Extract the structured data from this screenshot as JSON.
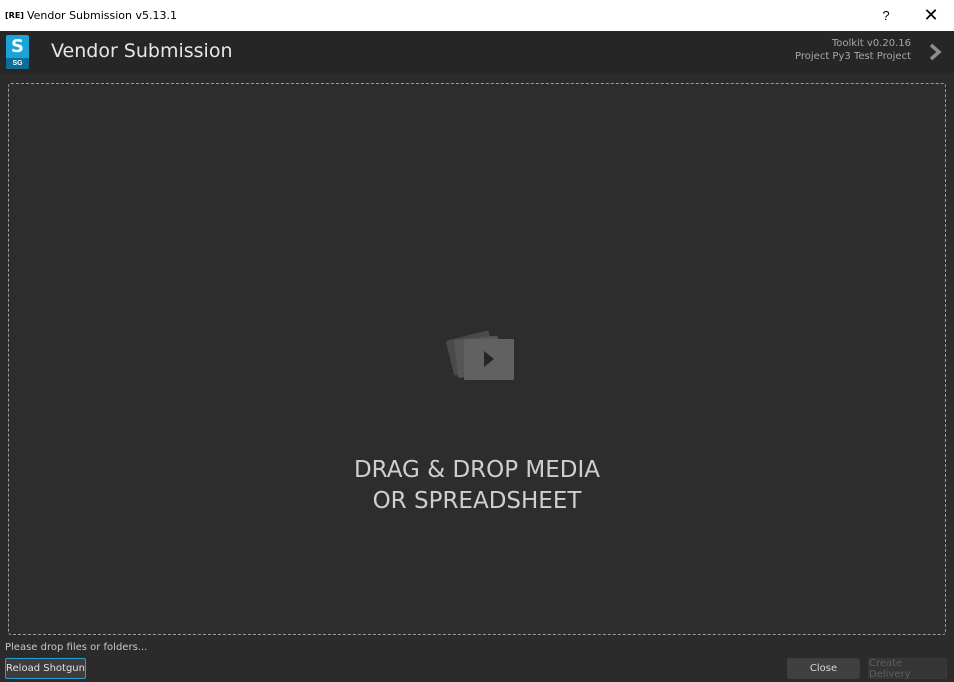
{
  "window": {
    "app_tag": "[RE]",
    "title": "Vendor Submission v5.13.1",
    "help_label": "?",
    "close_label": "✕"
  },
  "header": {
    "logo_letter": "S",
    "logo_sub": "SG",
    "title": "Vendor Submission",
    "toolkit_version": "Toolkit v0.20.16",
    "project": "Project Py3 Test Project",
    "accent_color": "#19a3d8"
  },
  "drop_zone": {
    "icon": "media-play-icon",
    "line1": "DRAG & DROP MEDIA",
    "line2": "OR SPREADSHEET"
  },
  "footer": {
    "status": "Please drop files or folders...",
    "reload_label": "Reload Shotgun",
    "close_label": "Close",
    "create_label": "Create Delivery"
  }
}
